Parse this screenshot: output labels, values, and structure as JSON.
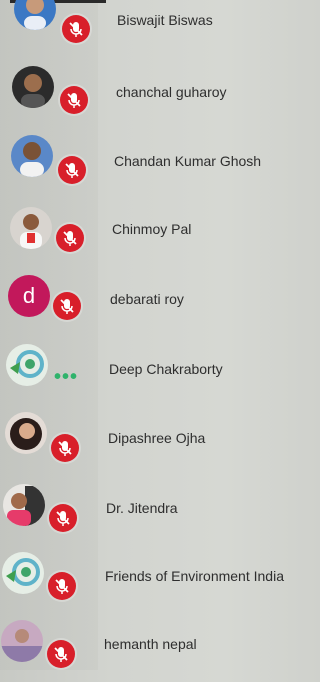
{
  "participants": [
    {
      "name": "Biswajit Biswas",
      "avatar": "photo",
      "status": "muted"
    },
    {
      "name": "chanchal guharoy",
      "avatar": "photo",
      "status": "muted"
    },
    {
      "name": "Chandan Kumar Ghosh",
      "avatar": "photo",
      "status": "muted"
    },
    {
      "name": "Chinmoy Pal",
      "avatar": "photo",
      "status": "muted"
    },
    {
      "name": "debarati roy",
      "avatar": "letter",
      "avatar_letter": "d",
      "status": "muted"
    },
    {
      "name": "Deep Chakraborty",
      "avatar": "logo",
      "status": "connecting"
    },
    {
      "name": "Dipashree Ojha",
      "avatar": "photo",
      "status": "muted"
    },
    {
      "name": "Dr. Jitendra",
      "avatar": "photo",
      "status": "muted"
    },
    {
      "name": "Friends of Environment India",
      "avatar": "logo",
      "status": "muted"
    },
    {
      "name": "hemanth nepal",
      "avatar": "photo",
      "status": "muted"
    }
  ],
  "icons": {
    "mute_badge": "mic-off-icon",
    "connecting": "more-dots-icon"
  },
  "colors": {
    "mute_badge": "#d81f2a",
    "letter_avatar": "#c2185b",
    "connecting_dots": "#2fb36b",
    "name_text": "#2e2e2e"
  }
}
